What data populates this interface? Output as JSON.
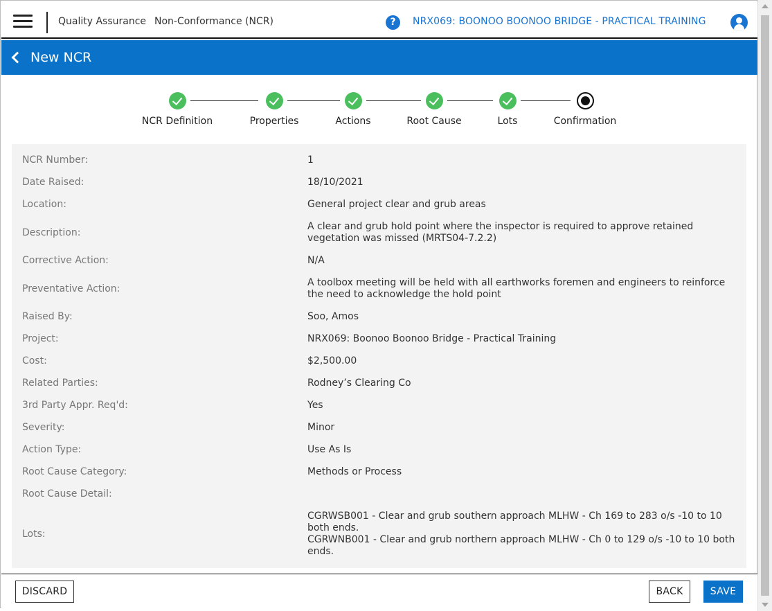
{
  "topbar": {
    "breadcrumb_module": "Quality Assurance",
    "breadcrumb_page": "Non-Conformance (NCR)",
    "help_icon": "?",
    "project": "NRX069: BOONOO BOONOO BRIDGE - PRACTICAL TRAINING"
  },
  "header": {
    "title": "New NCR"
  },
  "stepper": {
    "steps": [
      {
        "label": "NCR Definition",
        "status": "done"
      },
      {
        "label": "Properties",
        "status": "done"
      },
      {
        "label": "Actions",
        "status": "done"
      },
      {
        "label": "Root Cause",
        "status": "done"
      },
      {
        "label": "Lots",
        "status": "done"
      },
      {
        "label": "Confirmation",
        "status": "current"
      }
    ]
  },
  "details": [
    {
      "label": "NCR Number:",
      "value": "1"
    },
    {
      "label": "Date Raised:",
      "value": "18/10/2021"
    },
    {
      "label": "Location:",
      "value": "General project clear and grub areas"
    },
    {
      "label": "Description:",
      "value": "A clear and grub hold point where the inspector is required to approve retained vegetation was missed (MRTS04-7.2.2)"
    },
    {
      "label": "Corrective Action:",
      "value": "N/A"
    },
    {
      "label": "Preventative Action:",
      "value": "A toolbox meeting will be held with all earthworks foremen and engineers to reinforce the need to acknowledge the hold point"
    },
    {
      "label": "Raised By:",
      "value": "Soo, Amos"
    },
    {
      "label": "Project:",
      "value": "NRX069: Boonoo Boonoo Bridge - Practical Training"
    },
    {
      "label": "Cost:",
      "value": "$2,500.00"
    },
    {
      "label": "Related Parties:",
      "value": "Rodney’s Clearing Co"
    },
    {
      "label": "3rd Party Appr. Req'd:",
      "value": "Yes"
    },
    {
      "label": "Severity:",
      "value": "Minor"
    },
    {
      "label": "Action Type:",
      "value": "Use As Is"
    },
    {
      "label": "Root Cause Category:",
      "value": "Methods or Process"
    },
    {
      "label": "Root Cause Detail:",
      "value": ""
    },
    {
      "label": "Lots:",
      "value": "",
      "lines": [
        "CGRWSB001 - Clear and grub southern approach MLHW - Ch 169 to 283 o/s -10 to 10 both ends.",
        "CGRWNB001 - Clear and grub northern approach MLHW - Ch 0 to 129 o/s -10 to 10 both ends."
      ]
    }
  ],
  "footer": {
    "discard_label": "DISCARD",
    "back_label": "BACK",
    "save_label": "SAVE"
  },
  "colors": {
    "brand_blue": "#0a72c8",
    "step_done_green": "#4bbf5e"
  }
}
